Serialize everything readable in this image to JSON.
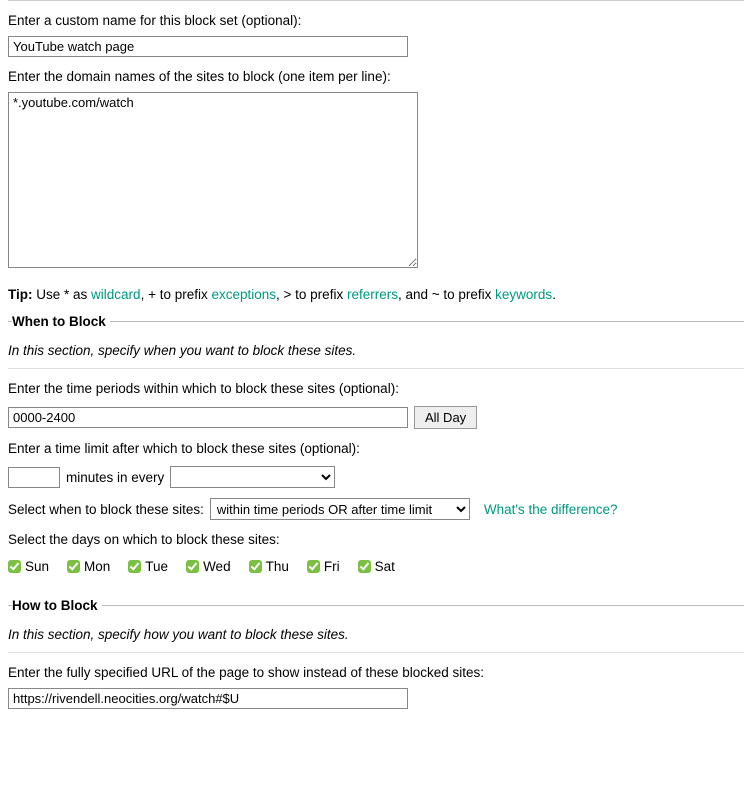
{
  "top": {
    "custom_name_label": "Enter a custom name for this block set (optional):",
    "custom_name_value": "YouTube watch page",
    "domains_label": "Enter the domain names of the sites to block (one item per line):",
    "domains_value": "*.youtube.com/watch",
    "tip_bold": "Tip:",
    "tip_t1": " Use * as ",
    "tip_link_wildcard": "wildcard",
    "tip_t2": ", + to prefix ",
    "tip_link_exceptions": "exceptions",
    "tip_t3": ", > to prefix ",
    "tip_link_referrers": "referrers",
    "tip_t4": ", and ~ to prefix ",
    "tip_link_keywords": "keywords",
    "tip_t5": "."
  },
  "when": {
    "legend": "When to Block",
    "intro": "In this section, specify when you want to block these sites.",
    "time_periods_label": "Enter the time periods within which to block these sites (optional):",
    "time_periods_value": "0000-2400",
    "all_day_btn": "All Day",
    "time_limit_label": "Enter a time limit after which to block these sites (optional):",
    "minutes_value": "",
    "minutes_in_every": "minutes in every",
    "per_unit_selected": "",
    "select_when_label": "Select when to block these sites:",
    "block_mode_selected": "within time periods OR after time limit",
    "whats_diff": "What's the difference?",
    "days_label": "Select the days on which to block these sites:",
    "days": [
      {
        "label": "Sun",
        "checked": true
      },
      {
        "label": "Mon",
        "checked": true
      },
      {
        "label": "Tue",
        "checked": true
      },
      {
        "label": "Wed",
        "checked": true
      },
      {
        "label": "Thu",
        "checked": true
      },
      {
        "label": "Fri",
        "checked": true
      },
      {
        "label": "Sat",
        "checked": true
      }
    ]
  },
  "how": {
    "legend": "How to Block",
    "intro": "In this section, specify how you want to block these sites.",
    "url_label": "Enter the fully specified URL of the page to show instead of these blocked sites:",
    "url_value": "https://rivendell.neocities.org/watch#$U"
  }
}
